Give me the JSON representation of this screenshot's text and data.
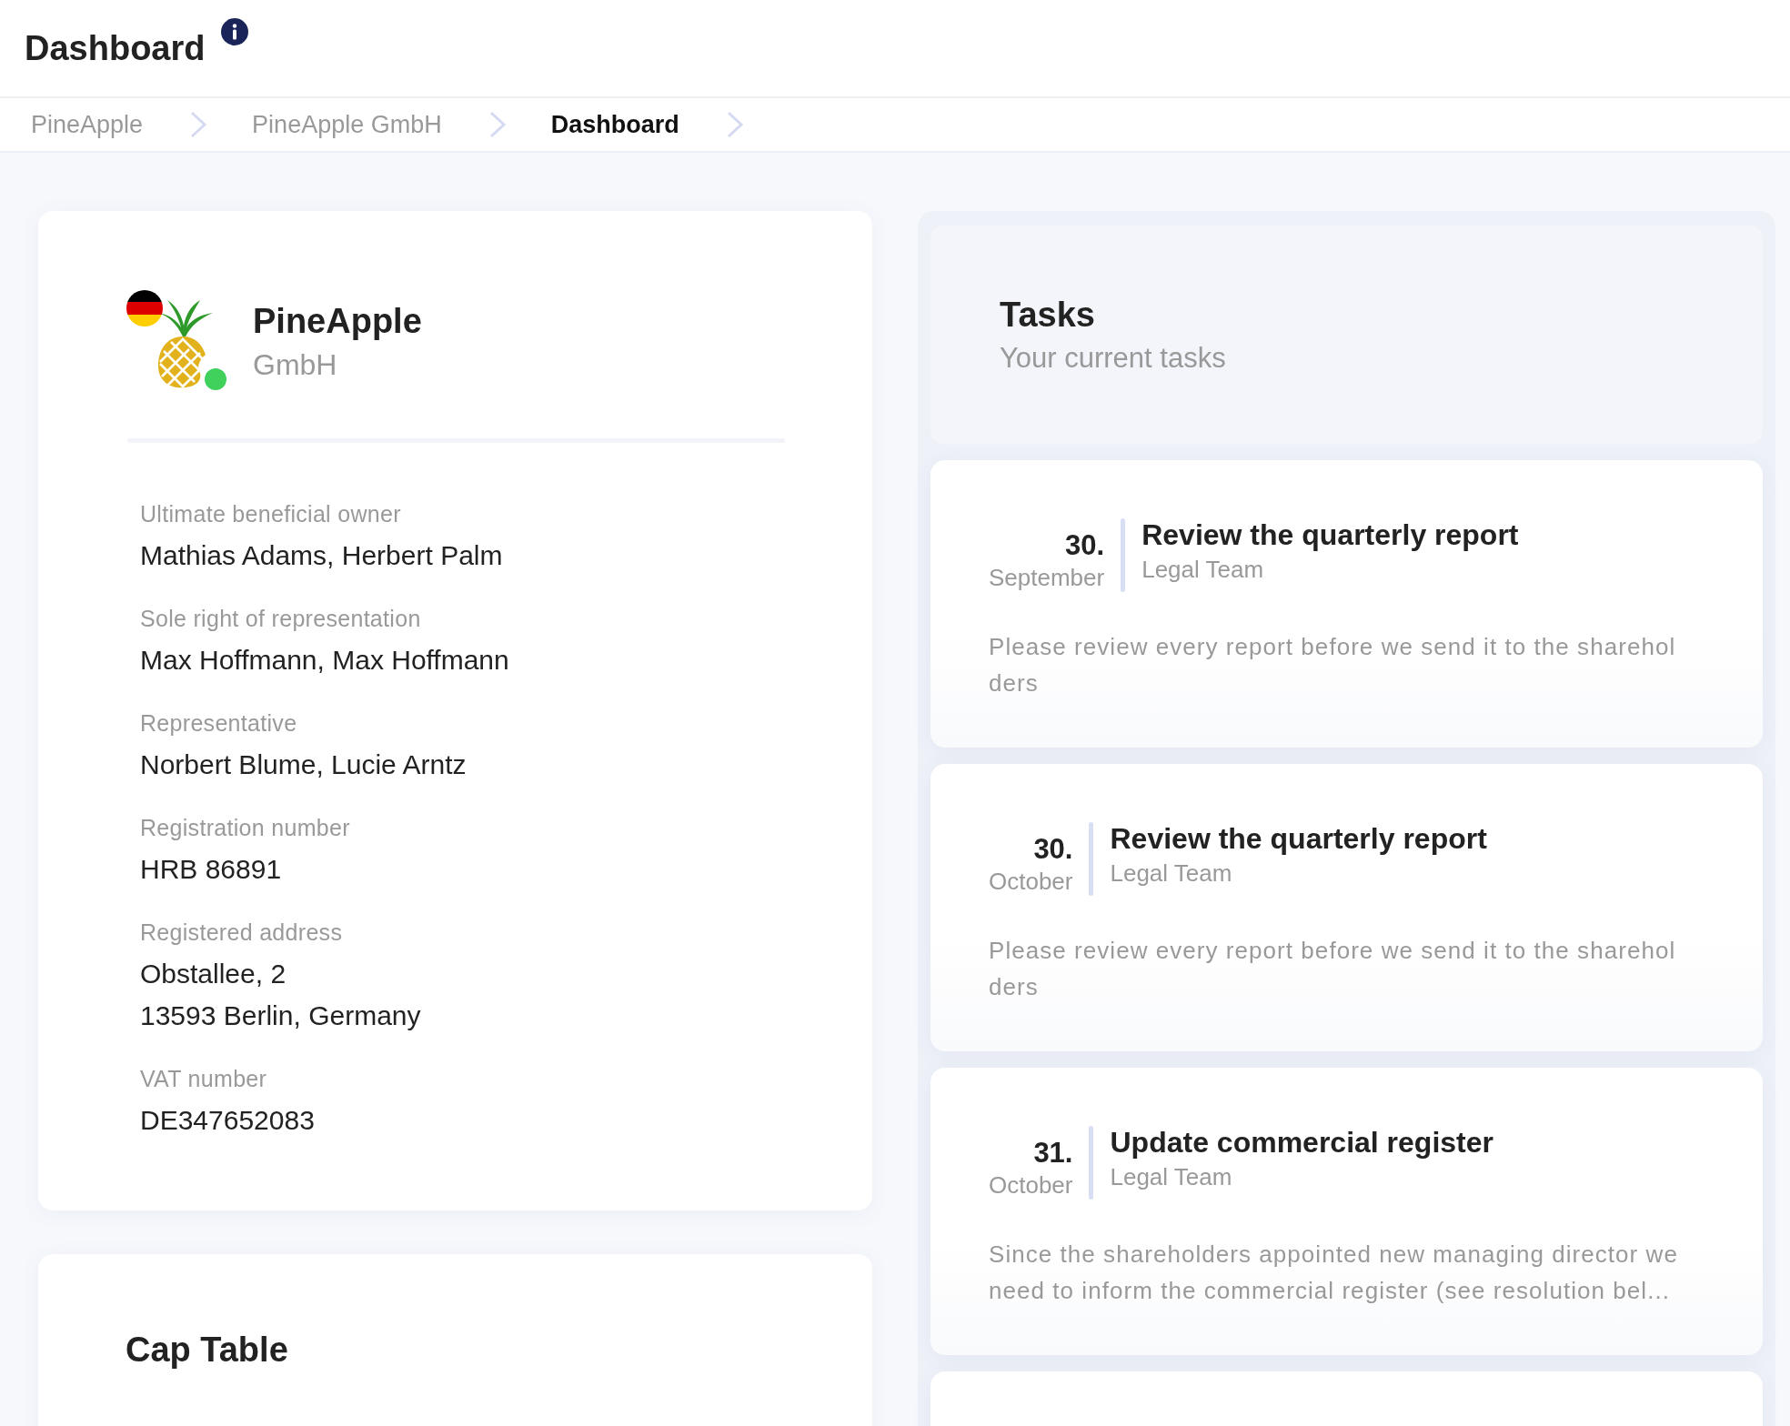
{
  "header": {
    "title": "Dashboard"
  },
  "breadcrumbs": [
    {
      "label": "PineApple",
      "selected": false
    },
    {
      "label": "PineApple GmbH",
      "selected": false
    },
    {
      "label": "Dashboard",
      "selected": true
    }
  ],
  "company": {
    "name": "PineApple",
    "legal_form": "GmbH",
    "online": true,
    "fields": [
      {
        "label": "Ultimate beneficial owner",
        "lines": [
          "Mathias Adams, Herbert Palm"
        ]
      },
      {
        "label": "Sole right of representation",
        "lines": [
          "Max Hoffmann, Max Hoffmann"
        ]
      },
      {
        "label": "Representative",
        "lines": [
          "Norbert Blume, Lucie Arntz"
        ]
      },
      {
        "label": "Registration number",
        "lines": [
          "HRB 86891"
        ]
      },
      {
        "label": "Registered address",
        "lines": [
          "Obstallee, 2",
          "13593 Berlin, Germany"
        ]
      },
      {
        "label": "VAT number",
        "lines": [
          "DE347652083"
        ]
      }
    ]
  },
  "cap_table": {
    "title": "Cap Table"
  },
  "tasks": {
    "title": "Tasks",
    "subtitle": "Your current tasks",
    "items": [
      {
        "day": "30.",
        "month": "September",
        "title": "Review the quarterly report",
        "team": "Legal Team",
        "description": "Please review every report before we send it to the shareholders"
      },
      {
        "day": "30.",
        "month": "October",
        "title": "Review the quarterly report",
        "team": "Legal Team",
        "description": "Please review every report before we send it to the shareholders"
      },
      {
        "day": "31.",
        "month": "October",
        "title": "Update commercial register",
        "team": "Legal Team",
        "description": "Since the shareholders appointed new managing director we need to inform the commercial register (see resolution bel..."
      }
    ]
  }
}
